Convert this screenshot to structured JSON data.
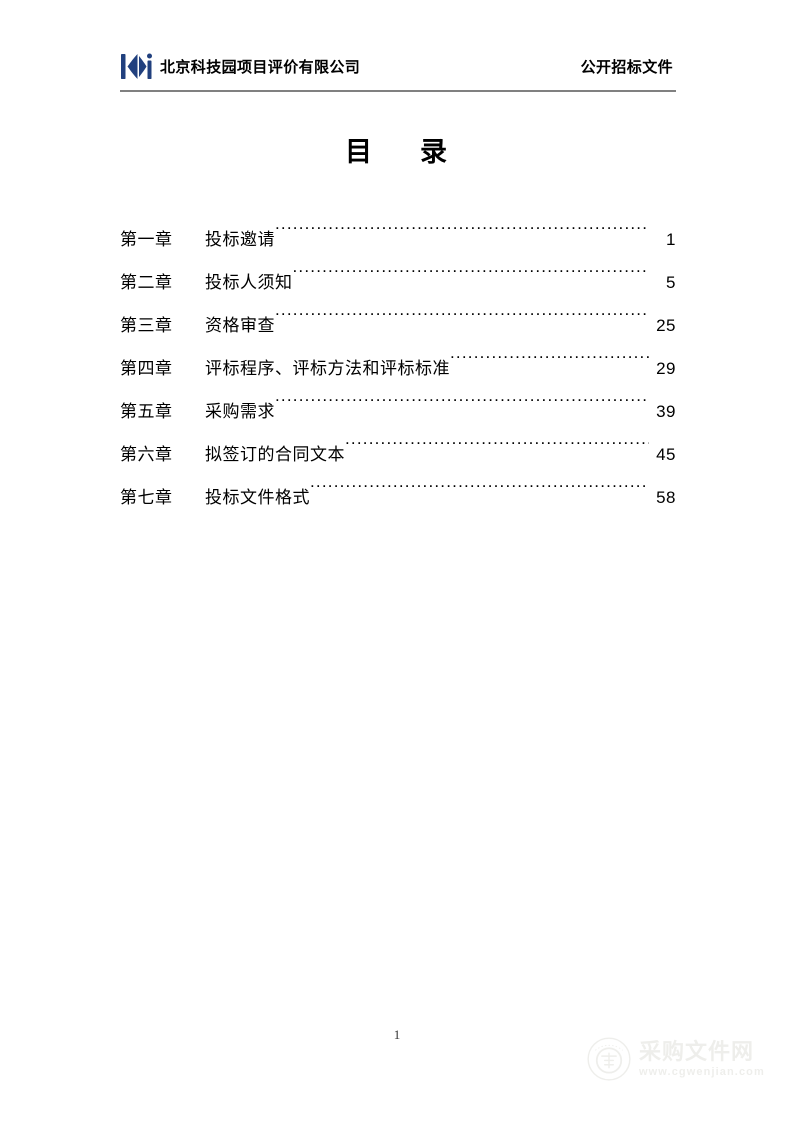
{
  "header": {
    "logo_icon": "company-diamond-logo-icon",
    "logo_color": "#21407e",
    "company_name": "北京科技园项目评价有限公司",
    "document_type": "公开招标文件",
    "rule_color": "#808080"
  },
  "title": {
    "left_char": "目",
    "right_char": "录"
  },
  "toc": {
    "entries": [
      {
        "chapter": "第一章",
        "title": "投标邀请",
        "page": "1"
      },
      {
        "chapter": "第二章",
        "title": "投标人须知",
        "page": "5"
      },
      {
        "chapter": "第三章",
        "title": "资格审查",
        "page": "25"
      },
      {
        "chapter": "第四章",
        "title": "评标程序、评标方法和评标标准",
        "page": "29"
      },
      {
        "chapter": "第五章",
        "title": "采购需求",
        "page": "39"
      },
      {
        "chapter": "第六章",
        "title": "拟签订的合同文本",
        "page": "45"
      },
      {
        "chapter": "第七章",
        "title": "投标文件格式",
        "page": "58"
      }
    ]
  },
  "footer": {
    "page_number": "1"
  },
  "watermark": {
    "seal_icon": "circular-seal-icon",
    "title": "采购文件网",
    "url": "www.cgwenjian.com",
    "color": "#9a9a8a"
  }
}
